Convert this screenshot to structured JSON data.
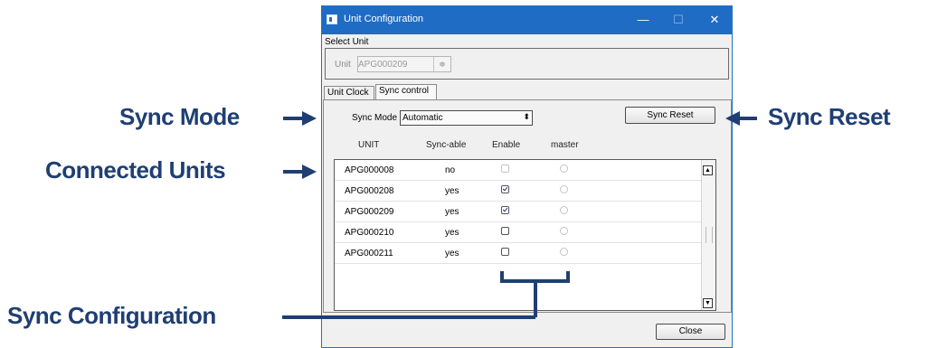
{
  "window": {
    "title": "Unit Configuration",
    "controls": {
      "minimize": "—",
      "maximize": "☐",
      "close": "✕"
    }
  },
  "select_unit": {
    "label": "Select Unit",
    "unit_label": "Unit",
    "unit_value": "APG000209",
    "spin_glyph": "≑"
  },
  "tabs": [
    {
      "label": "Unit Clock",
      "selected": false
    },
    {
      "label": "Sync control",
      "selected": true
    }
  ],
  "sync": {
    "mode_label": "Sync Mode",
    "mode_value": "Automatic",
    "combo_arrow": "⬍",
    "reset_label": "Sync Reset"
  },
  "table": {
    "columns": [
      "UNIT",
      "Sync-able",
      "Enable",
      "master"
    ],
    "rows": [
      {
        "unit": "APG000008",
        "syncable": "no",
        "enabled": false,
        "enable_disabled": true,
        "master": false
      },
      {
        "unit": "APG000208",
        "syncable": "yes",
        "enabled": true,
        "enable_disabled": false,
        "master": false
      },
      {
        "unit": "APG000209",
        "syncable": "yes",
        "enabled": true,
        "enable_disabled": false,
        "master": false
      },
      {
        "unit": "APG000210",
        "syncable": "yes",
        "enabled": false,
        "enable_disabled": false,
        "master": false
      },
      {
        "unit": "APG000211",
        "syncable": "yes",
        "enabled": false,
        "enable_disabled": false,
        "master": false
      }
    ],
    "scroll_up": "▲",
    "scroll_down": "▼"
  },
  "close_label": "Close",
  "annotations": {
    "sync_mode": "Sync Mode",
    "connected_units": "Connected Units",
    "sync_reset": "Sync Reset",
    "sync_configuration": "Sync Configuration"
  },
  "colors": {
    "titlebar": "#1f6cc4",
    "annotation": "#1f3f73"
  }
}
